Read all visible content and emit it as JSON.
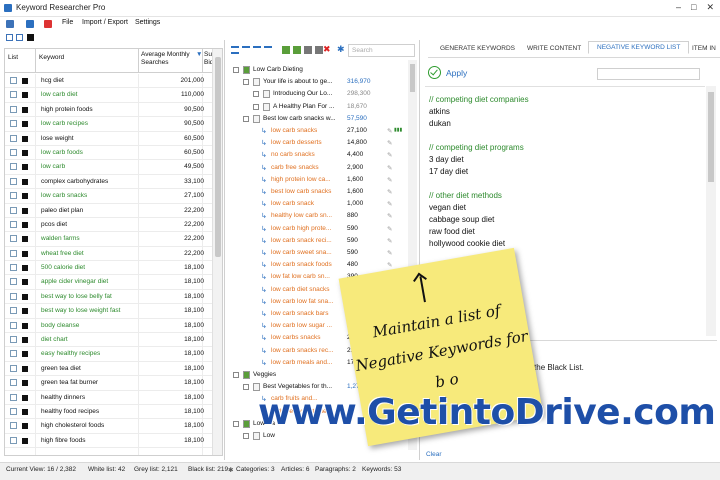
{
  "window": {
    "title": "Keyword Researcher Pro"
  },
  "menu": [
    "File",
    "Import / Export",
    "Settings"
  ],
  "left_grid": {
    "headers": [
      "List",
      "Keyword",
      "Average Monthly Searches",
      "Sug Bid"
    ],
    "rows": [
      {
        "kw": "hcg diet",
        "v": "201,000",
        "green": false
      },
      {
        "kw": "low carb diet",
        "v": "110,000",
        "green": true
      },
      {
        "kw": "high protein foods",
        "v": "90,500",
        "green": false
      },
      {
        "kw": "low carb recipes",
        "v": "90,500",
        "green": true
      },
      {
        "kw": "lose weight",
        "v": "60,500",
        "green": false
      },
      {
        "kw": "low carb foods",
        "v": "60,500",
        "green": true
      },
      {
        "kw": "low carb",
        "v": "49,500",
        "green": true
      },
      {
        "kw": "complex carbohydrates",
        "v": "33,100",
        "green": false
      },
      {
        "kw": "low carb snacks",
        "v": "27,100",
        "green": true
      },
      {
        "kw": "paleo diet plan",
        "v": "22,200",
        "green": false
      },
      {
        "kw": "pcos diet",
        "v": "22,200",
        "green": false
      },
      {
        "kw": "walden farms",
        "v": "22,200",
        "green": true
      },
      {
        "kw": "wheat free diet",
        "v": "22,200",
        "green": true
      },
      {
        "kw": "500 calorie diet",
        "v": "18,100",
        "green": true
      },
      {
        "kw": "apple cider vinegar diet",
        "v": "18,100",
        "green": true
      },
      {
        "kw": "best way to lose belly fat",
        "v": "18,100",
        "green": true
      },
      {
        "kw": "best way to lose weight fast",
        "v": "18,100",
        "green": true
      },
      {
        "kw": "body cleanse",
        "v": "18,100",
        "green": true
      },
      {
        "kw": "diet chart",
        "v": "18,100",
        "green": true
      },
      {
        "kw": "easy healthy recipes",
        "v": "18,100",
        "green": true
      },
      {
        "kw": "green tea diet",
        "v": "18,100",
        "green": false
      },
      {
        "kw": "green tea fat burner",
        "v": "18,100",
        "green": false
      },
      {
        "kw": "healthy dinners",
        "v": "18,100",
        "green": false
      },
      {
        "kw": "healthy food recipes",
        "v": "18,100",
        "green": false
      },
      {
        "kw": "high cholesterol foods",
        "v": "18,100",
        "green": false
      },
      {
        "kw": "high fibre foods",
        "v": "18,100",
        "green": false
      }
    ]
  },
  "status": {
    "current_view": "Current View: 16 / 2,382",
    "white_list": "White list: 42",
    "grey_list": "Grey list: 2,121",
    "black_list": "Black list: 219",
    "categories": "Categories: 3",
    "articles": "Articles: 6",
    "paragraphs": "Paragraphs: 2",
    "keywords": "Keywords: 53"
  },
  "tree": {
    "search_placeholder": "Search",
    "rows": [
      {
        "t": "Low Carb Dieting",
        "n": "",
        "lvl": 0,
        "c": "dark",
        "num_c": "dark"
      },
      {
        "t": "Your life is about to ge...",
        "n": "316,970",
        "lvl": 1,
        "c": "dark",
        "num_c": "blue"
      },
      {
        "t": "Introducing Our Lo...",
        "n": "298,300",
        "lvl": 2,
        "c": "dark",
        "num_c": "grey"
      },
      {
        "t": "A Healthy Plan For ...",
        "n": "18,670",
        "lvl": 2,
        "c": "dark",
        "num_c": "grey"
      },
      {
        "t": "Best low carb snacks w...",
        "n": "57,590",
        "lvl": 1,
        "c": "dark",
        "num_c": "blue"
      },
      {
        "t": "low carb snacks",
        "n": "27,100",
        "lvl": 3,
        "c": "orange",
        "num_c": "dark",
        "tags": true
      },
      {
        "t": "low carb desserts",
        "n": "14,800",
        "lvl": 3,
        "c": "mixed",
        "num_c": "dark"
      },
      {
        "t": "no carb snacks",
        "n": "4,400",
        "lvl": 3,
        "c": "orange",
        "num_c": "dark"
      },
      {
        "t": "carb free snacks",
        "n": "2,900",
        "lvl": 3,
        "c": "mixed",
        "num_c": "dark"
      },
      {
        "t": "high protein low ca...",
        "n": "1,600",
        "lvl": 3,
        "c": "orange",
        "num_c": "dark"
      },
      {
        "t": "best low carb snacks",
        "n": "1,600",
        "lvl": 3,
        "c": "orange",
        "num_c": "dark"
      },
      {
        "t": "low carb snack",
        "n": "1,000",
        "lvl": 3,
        "c": "orange",
        "num_c": "dark"
      },
      {
        "t": "healthy low carb sn...",
        "n": "880",
        "lvl": 3,
        "c": "orange",
        "num_c": "dark"
      },
      {
        "t": "low carb high prote...",
        "n": "590",
        "lvl": 3,
        "c": "orange",
        "num_c": "dark"
      },
      {
        "t": "low carb snack reci...",
        "n": "590",
        "lvl": 3,
        "c": "mixed",
        "num_c": "dark"
      },
      {
        "t": "low carb sweet sna...",
        "n": "590",
        "lvl": 3,
        "c": "mixed",
        "num_c": "dark"
      },
      {
        "t": "low carb snack foods",
        "n": "480",
        "lvl": 3,
        "c": "orange",
        "num_c": "dark"
      },
      {
        "t": "low fat low carb sn...",
        "n": "390",
        "lvl": 3,
        "c": "orange",
        "num_c": "dark"
      },
      {
        "t": "low carb diet snacks",
        "n": "390",
        "lvl": 3,
        "c": "orange",
        "num_c": "dark"
      },
      {
        "t": "low carb low fat sna...",
        "n": "390",
        "lvl": 3,
        "c": "orange",
        "num_c": "dark"
      },
      {
        "t": "low carb snack bars",
        "n": "320",
        "lvl": 3,
        "c": "orange",
        "num_c": "dark"
      },
      {
        "t": "low carb low sugar ...",
        "n": "260",
        "lvl": 3,
        "c": "mixed",
        "num_c": "dark"
      },
      {
        "t": "low carbs snacks",
        "n": "260",
        "lvl": 3,
        "c": "orange",
        "num_c": "dark"
      },
      {
        "t": "low carb snacks rec...",
        "n": "210",
        "lvl": 3,
        "c": "mixed",
        "num_c": "dark"
      },
      {
        "t": "low carb meals and...",
        "n": "170",
        "lvl": 3,
        "c": "mixed",
        "num_c": "dark"
      },
      {
        "t": "Veggies",
        "n": "",
        "lvl": 0,
        "c": "dark",
        "num_c": "dark"
      },
      {
        "t": "Best Vegetables for th...",
        "n": "1,270",
        "lvl": 1,
        "c": "dark",
        "num_c": "blue"
      },
      {
        "t": "carb fruits and...",
        "n": "",
        "lvl": 3,
        "c": "mixed",
        "num_c": "dark"
      },
      {
        "t": "carb free vegetables",
        "n": "",
        "lvl": 3,
        "c": "mixed",
        "num_c": "dark"
      },
      {
        "t": "Low Ca",
        "n": "",
        "lvl": 0,
        "c": "dark",
        "num_c": "dark"
      },
      {
        "t": "Low",
        "n": "",
        "lvl": 1,
        "c": "dark",
        "num_c": "dark"
      }
    ]
  },
  "right": {
    "tabs": [
      "GENERATE KEYWORDS",
      "WRITE CONTENT",
      "NEGATIVE KEYWORD LIST",
      "ITEM IN"
    ],
    "apply": "Apply",
    "neg_lines": [
      {
        "t": "// competing diet companies",
        "cmt": true
      },
      {
        "t": "atkins",
        "cmt": false
      },
      {
        "t": "dukan",
        "cmt": false
      },
      {
        "t": "",
        "cmt": false
      },
      {
        "t": "// competing diet programs",
        "cmt": true
      },
      {
        "t": "3 day diet",
        "cmt": false
      },
      {
        "t": "17 day diet",
        "cmt": false
      },
      {
        "t": "",
        "cmt": false
      },
      {
        "t": "// other diet methods",
        "cmt": true
      },
      {
        "t": "vegan diet",
        "cmt": false
      },
      {
        "t": "cabbage soup diet",
        "cmt": false
      },
      {
        "t": "raw food diet",
        "cmt": false
      },
      {
        "t": "hollywood cookie diet",
        "cmt": false
      }
    ],
    "lower_text": "ed to the Black List.",
    "clear": "Clear"
  },
  "sticky_note": [
    "Maintain a list of",
    "Negative Keywords for",
    "b    o"
  ],
  "watermark": "www.GetintoDrive.com",
  "colors": {
    "green": "#2e8b2e",
    "orange": "#e07020",
    "blue": "#2b6fbf"
  }
}
